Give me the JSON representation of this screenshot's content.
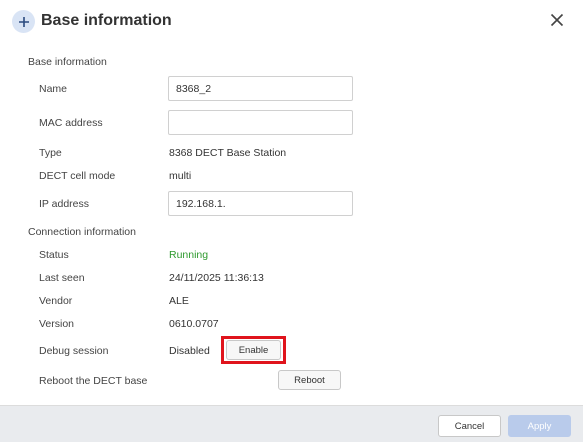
{
  "dialog": {
    "title": "Base information",
    "close_icon": "close-icon",
    "add_icon": "plus-icon"
  },
  "base_info": {
    "heading": "Base information",
    "name_label": "Name",
    "name_value": "8368_2",
    "mac_label": "MAC address",
    "mac_value": "",
    "type_label": "Type",
    "type_value": "8368 DECT Base Station",
    "cell_mode_label": "DECT cell mode",
    "cell_mode_value": "multi",
    "ip_label": "IP address",
    "ip_value": "192.168.1."
  },
  "connection_info": {
    "heading": "Connection information",
    "status_label": "Status",
    "status_value": "Running",
    "last_seen_label": "Last seen",
    "last_seen_value": "24/11/2025 11:36:13",
    "vendor_label": "Vendor",
    "vendor_value": "ALE",
    "version_label": "Version",
    "version_value": "0610.0707",
    "debug_label": "Debug session",
    "debug_value": "Disabled",
    "enable_button": "Enable",
    "reboot_label": "Reboot the DECT base",
    "reboot_button": "Reboot"
  },
  "footer": {
    "cancel_button": "Cancel",
    "apply_button": "Apply"
  },
  "colors": {
    "status_running": "#2e9a2e",
    "highlight": "#e0141c",
    "apply_disabled": "#b9cbeb"
  }
}
